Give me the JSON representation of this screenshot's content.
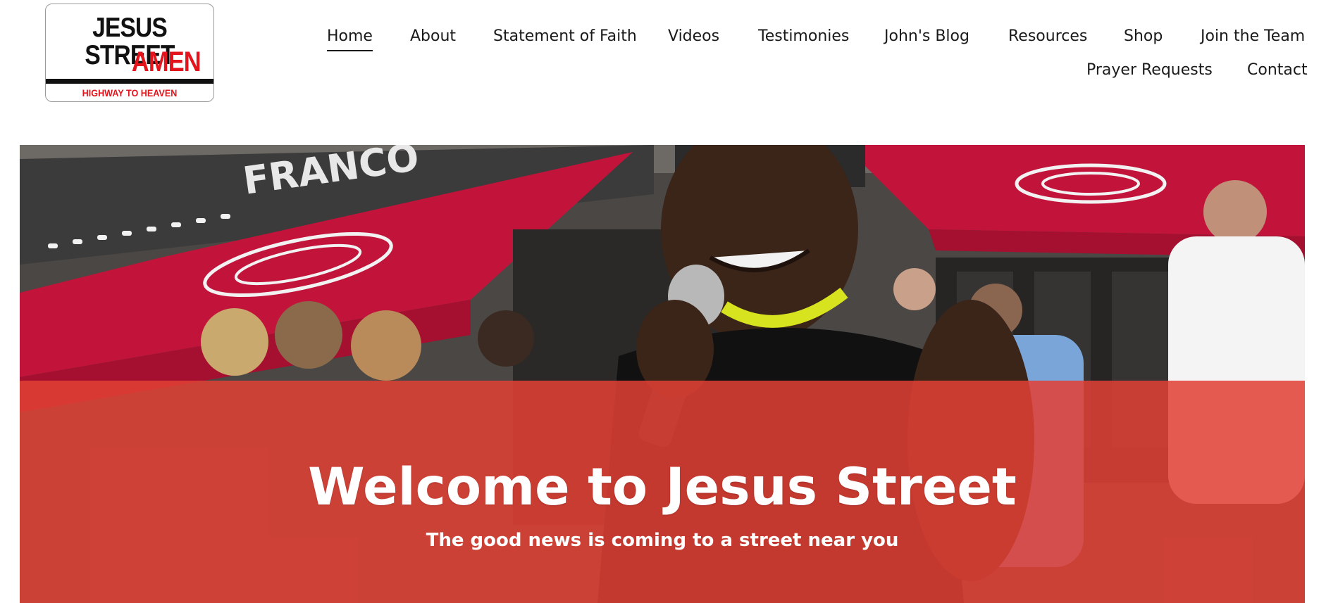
{
  "logo": {
    "line1": "JESUS STREET",
    "line2": "AMEN",
    "line3": "HIGHWAY TO HEAVEN"
  },
  "nav": {
    "items": [
      {
        "label": "Home",
        "active": true
      },
      {
        "label": "About"
      },
      {
        "label": "Statement of Faith"
      },
      {
        "label": "Videos"
      },
      {
        "label": "Testimonies"
      },
      {
        "label": "John's Blog"
      },
      {
        "label": "Resources"
      },
      {
        "label": "Shop"
      },
      {
        "label": "Join the Team"
      },
      {
        "label": "Prayer Requests"
      },
      {
        "label": "Contact"
      }
    ]
  },
  "hero": {
    "title": "Welcome to Jesus Street",
    "subtitle": "The good news is coming to a street near you",
    "awning_text": "FRANCO"
  },
  "colors": {
    "brand_red": "#e3141c",
    "overlay_red": "#e24034",
    "text_dark": "#1a1a1a"
  }
}
